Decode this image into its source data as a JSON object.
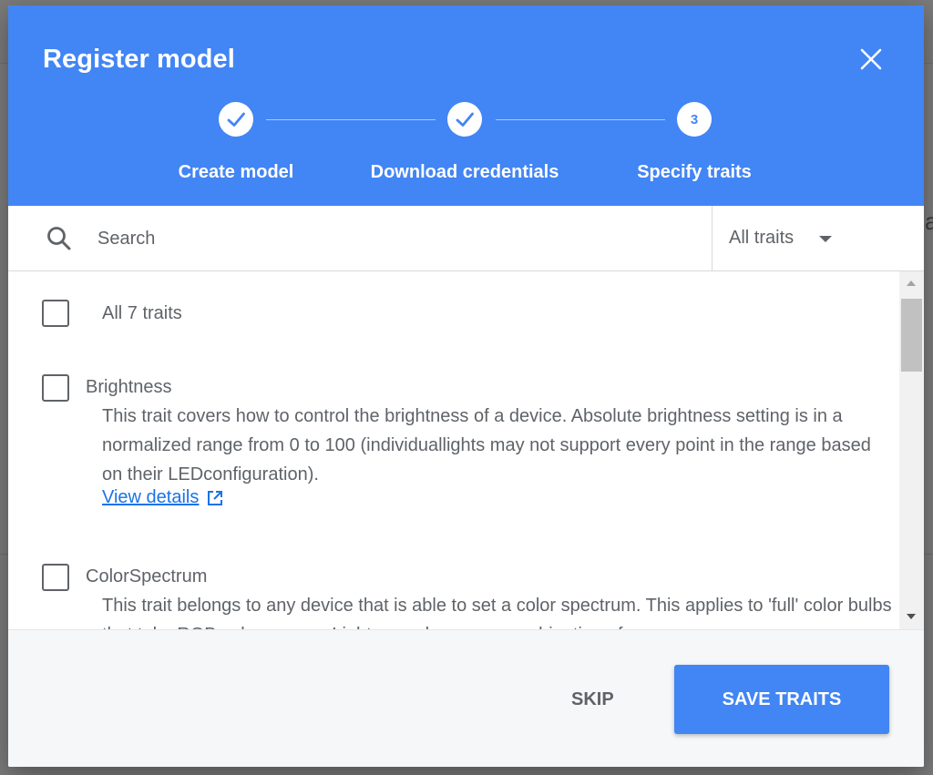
{
  "dialog": {
    "title": "Register model",
    "close_icon": "close-icon"
  },
  "stepper": {
    "steps": [
      {
        "label": "Create model",
        "state": "complete",
        "icon": "check-icon"
      },
      {
        "label": "Download credentials",
        "state": "complete",
        "icon": "check-icon"
      },
      {
        "label": "Specify traits",
        "state": "active",
        "number": "3"
      }
    ]
  },
  "search": {
    "placeholder": "Search",
    "value": "",
    "icon": "search-icon"
  },
  "filter": {
    "selected": "All traits"
  },
  "traits": {
    "all_label": "All 7 traits",
    "items": [
      {
        "name": "Brightness",
        "description": "This trait covers how to control the brightness of a device. Absolute brightness setting is in a normalized range from 0 to 100 (individuallights may not support every point in the range based on their LEDconfiguration).",
        "link_label": "View details",
        "link_icon": "open-in-new-icon",
        "checked": false
      },
      {
        "name": "ColorSpectrum",
        "description": "This trait belongs to any device that is able to set a color spectrum. This applies to 'full' color bulbs that take RGB color ranges. Lights may have any combination of",
        "checked": false
      }
    ]
  },
  "footer": {
    "skip_label": "SKIP",
    "save_label": "SAVE TRAITS"
  },
  "colors": {
    "header_blue": "#4285f4",
    "link_blue": "#1a73e8",
    "text_gray": "#5f6368"
  }
}
